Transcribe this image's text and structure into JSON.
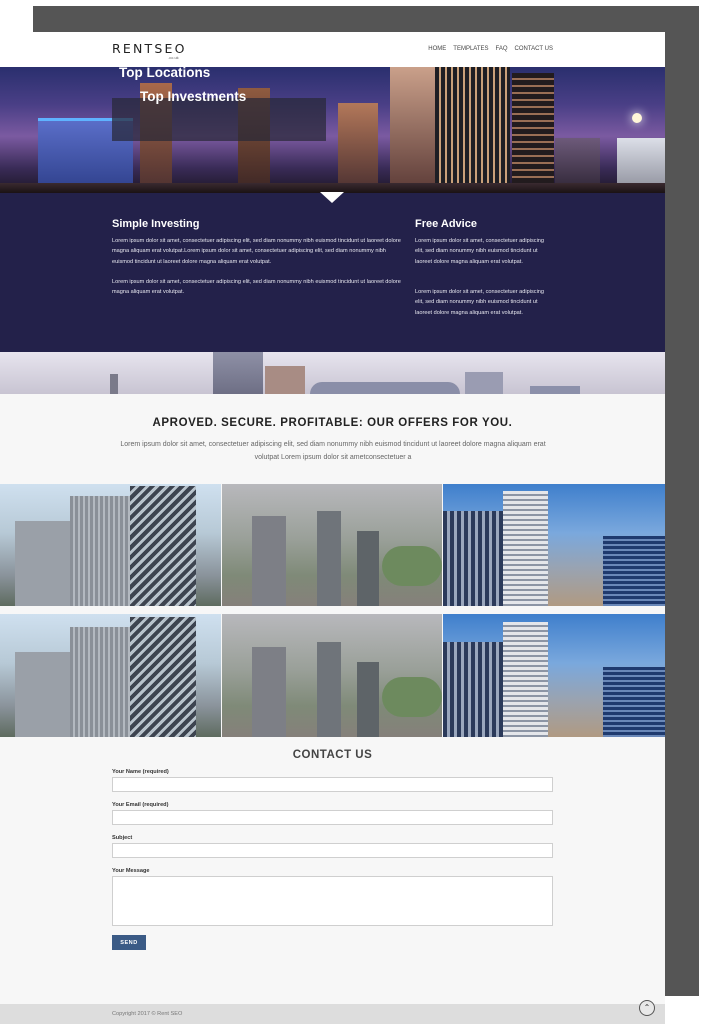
{
  "brand": {
    "name": "RENTSEO",
    "sub": ".co.uk"
  },
  "nav": [
    {
      "label": "HOME"
    },
    {
      "label": "TEMPLATES"
    },
    {
      "label": "FAQ"
    },
    {
      "label": "CONTACT US"
    }
  ],
  "hero": {
    "line1": "Top Locations",
    "line2": "Top Investments"
  },
  "features": {
    "left": {
      "title": "Simple Investing",
      "p1": "Lorem ipsum dolor sit amet, consectetuer adipiscing elit, sed diam nonummy nibh euismod tincidunt ut laoreet dolore magna aliquam erat volutpat.Lorem ipsum dolor sit amet, consectetuer adipiscing elit, sed diam nonummy nibh euismod tincidunt ut laoreet dolore magna aliquam erat volutpat.",
      "p2": "Lorem ipsum dolor sit amet, consectetuer adipiscing elit, sed diam nonummy nibh euismod tincidunt ut laoreet dolore magna aliquam erat volutpat."
    },
    "right": {
      "title": "Free Advice",
      "p1": "Lorem ipsum dolor sit amet, consectetuer adipiscing elit, sed diam nonummy nibh euismod tincidunt ut laoreet dolore magna aliquam erat volutpat.",
      "p2": "Lorem ipsum dolor sit amet, consectetuer adipiscing elit, sed diam nonummy nibh euismod tincidunt ut laoreet dolore magna aliquam erat volutpat."
    }
  },
  "offers": {
    "title": "APROVED. SECURE. PROFITABLE: OUR OFFERS FOR YOU.",
    "text": "Lorem ipsum dolor sit amet, consectetuer adipiscing elit, sed diam nonummy nibh euismod tincidunt ut laoreet dolore magna aliquam erat volutpat Lorem ipsum dolor sit ametconsectetuer a"
  },
  "contact": {
    "title": "CONTACT US",
    "name_label": "Your Name (required)",
    "email_label": "Your Email (required)",
    "subject_label": "Subject",
    "message_label": "Your Message",
    "name_value": "",
    "email_value": "",
    "subject_value": "",
    "send_label": "SEND"
  },
  "footer": {
    "copyright": "Copyright 2017 © Rent SEO"
  },
  "colors": {
    "dark_band": "#23214a",
    "send_button": "#3b5b86",
    "frame_shadow": "#555555"
  },
  "icons": {
    "back_to_top": "chevron-up-icon"
  }
}
